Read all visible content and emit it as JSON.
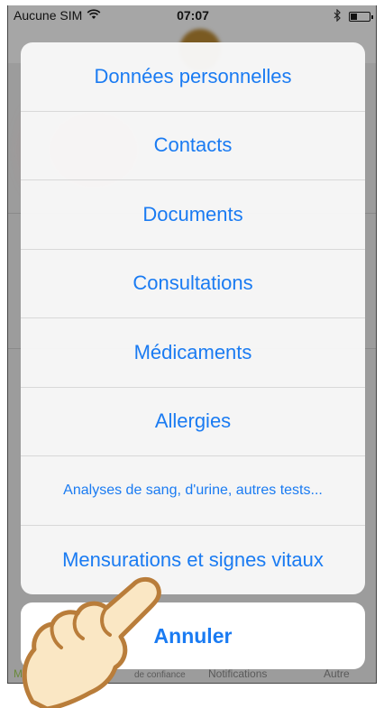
{
  "status_bar": {
    "carrier": "Aucune SIM",
    "time": "07:07"
  },
  "action_sheet": {
    "items": [
      "Données personnelles",
      "Contacts",
      "Documents",
      "Consultations",
      "Médicaments",
      "Allergies",
      "Analyses de sang, d'urine, autres tests...",
      "Mensurations et signes vitaux"
    ],
    "cancel_label": "Annuler"
  },
  "tab_bar": {
    "tabs": [
      "M",
      "de confiance",
      "Notifications",
      "Autre"
    ]
  },
  "colors": {
    "accent": "#1a7bf2",
    "hand_fill": "#fae7c4",
    "hand_stroke": "#b97d3a"
  }
}
